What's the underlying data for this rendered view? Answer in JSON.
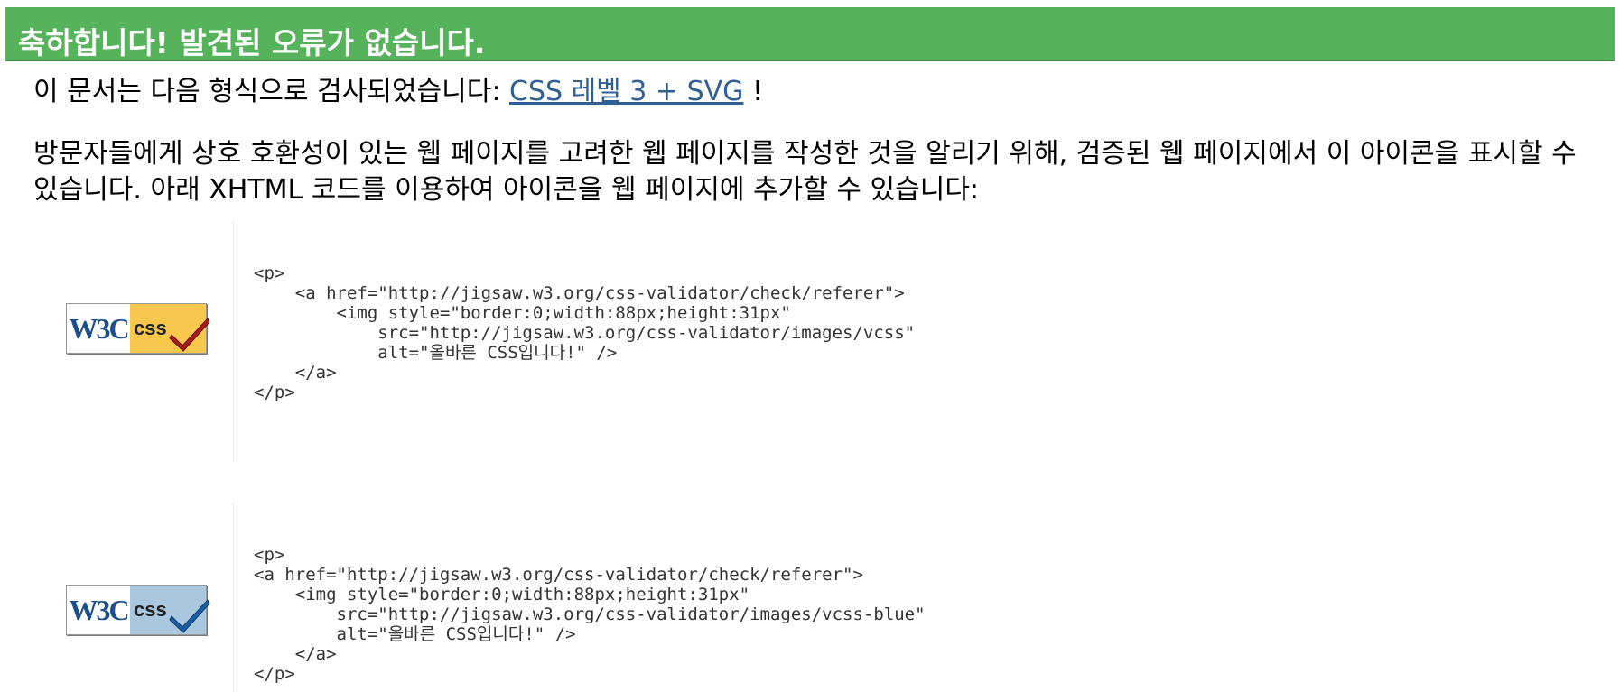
{
  "banner": {
    "title": "축하합니다! 발견된 오류가 없습니다."
  },
  "intro": {
    "prefix": "이 문서는 다음 형식으로 검사되었습니다: ",
    "link_label": "CSS 레벨 3 + SVG",
    "suffix": " !"
  },
  "notice": {
    "text": "방문자들에게 상호 호환성이 있는 웹 페이지를 고려한 웹 페이지를 작성한 것을 알리기 위해, 검증된 웹 페이지에서 이 아이콘을 표시할 수 있습니다. 아래 XHTML 코드를 이용하여 아이콘을 웹 페이지에 추가할 수 있습니다:"
  },
  "badges": [
    {
      "w3c_label": "W3C",
      "css_label": "css",
      "variant": "gold",
      "bg_color": "#f8c84d",
      "check_color": "#a81b1b",
      "code": "<p>\n    <a href=\"http://jigsaw.w3.org/css-validator/check/referer\">\n        <img style=\"border:0;width:88px;height:31px\"\n            src=\"http://jigsaw.w3.org/css-validator/images/vcss\"\n            alt=\"올바른 CSS입니다!\" />\n    </a>\n</p>"
    },
    {
      "w3c_label": "W3C",
      "css_label": "css",
      "variant": "blue",
      "bg_color": "#a9c7df",
      "check_color": "#1a5ea6",
      "code": "<p>\n<a href=\"http://jigsaw.w3.org/css-validator/check/referer\">\n    <img style=\"border:0;width:88px;height:31px\"\n        src=\"http://jigsaw.w3.org/css-validator/images/vcss-blue\"\n        alt=\"올바른 CSS입니다!\" />\n    </a>\n</p>"
    }
  ],
  "colors": {
    "banner_bg": "#57b25c",
    "link": "#2f5f95"
  }
}
